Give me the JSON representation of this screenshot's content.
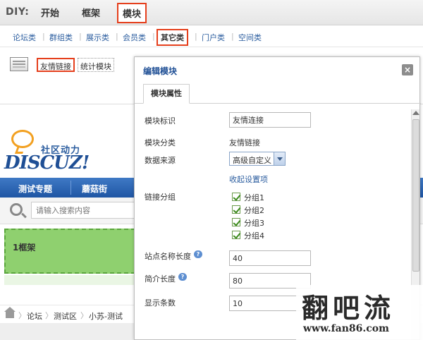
{
  "diy_bar": {
    "label": "DIY:",
    "tabs": [
      "开始",
      "框架",
      "模块"
    ]
  },
  "categories": [
    {
      "label": "论坛类"
    },
    {
      "label": "群组类"
    },
    {
      "label": "展示类"
    },
    {
      "label": "会员类"
    },
    {
      "label": "其它类"
    },
    {
      "label": "门户类"
    },
    {
      "label": "空间类"
    }
  ],
  "modules": [
    "友情链接",
    "统计模块"
  ],
  "background_page": {
    "logo": {
      "slogan": "社区动力",
      "wordmark": "DISCUZ!"
    },
    "nav": [
      "测试专题",
      "蘑菇街"
    ],
    "search_placeholder": "请输入搜索内容",
    "frame_label": "1框架",
    "breadcrumb": [
      "论坛",
      "测试区",
      "小苏-测试"
    ]
  },
  "dialog": {
    "title": "编辑模块",
    "close": "×",
    "tab": "模块属性",
    "fields": {
      "module_id_label": "模块标识",
      "module_id_value": "友情连接",
      "category_label": "模块分类",
      "category_value": "友情链接",
      "source_label": "数据来源",
      "source_value": "高级自定义",
      "collapse_link": "收起设置项",
      "group_label": "链接分组",
      "groups": [
        "分组1",
        "分组2",
        "分组3",
        "分组4"
      ],
      "name_length_label": "站点名称长度",
      "name_length_value": "40",
      "intro_length_label": "简介长度",
      "intro_length_value": "80",
      "count_label": "显示条数",
      "count_value": "10",
      "help_glyph": "?"
    }
  },
  "watermark": {
    "title": "翻吧流",
    "url": "www.fan86.com"
  },
  "colors": {
    "accent_red": "#e53f1c",
    "link_blue": "#2b5d9f",
    "nav_blue": "#1f56a4",
    "frame_green": "#8fd06f"
  }
}
